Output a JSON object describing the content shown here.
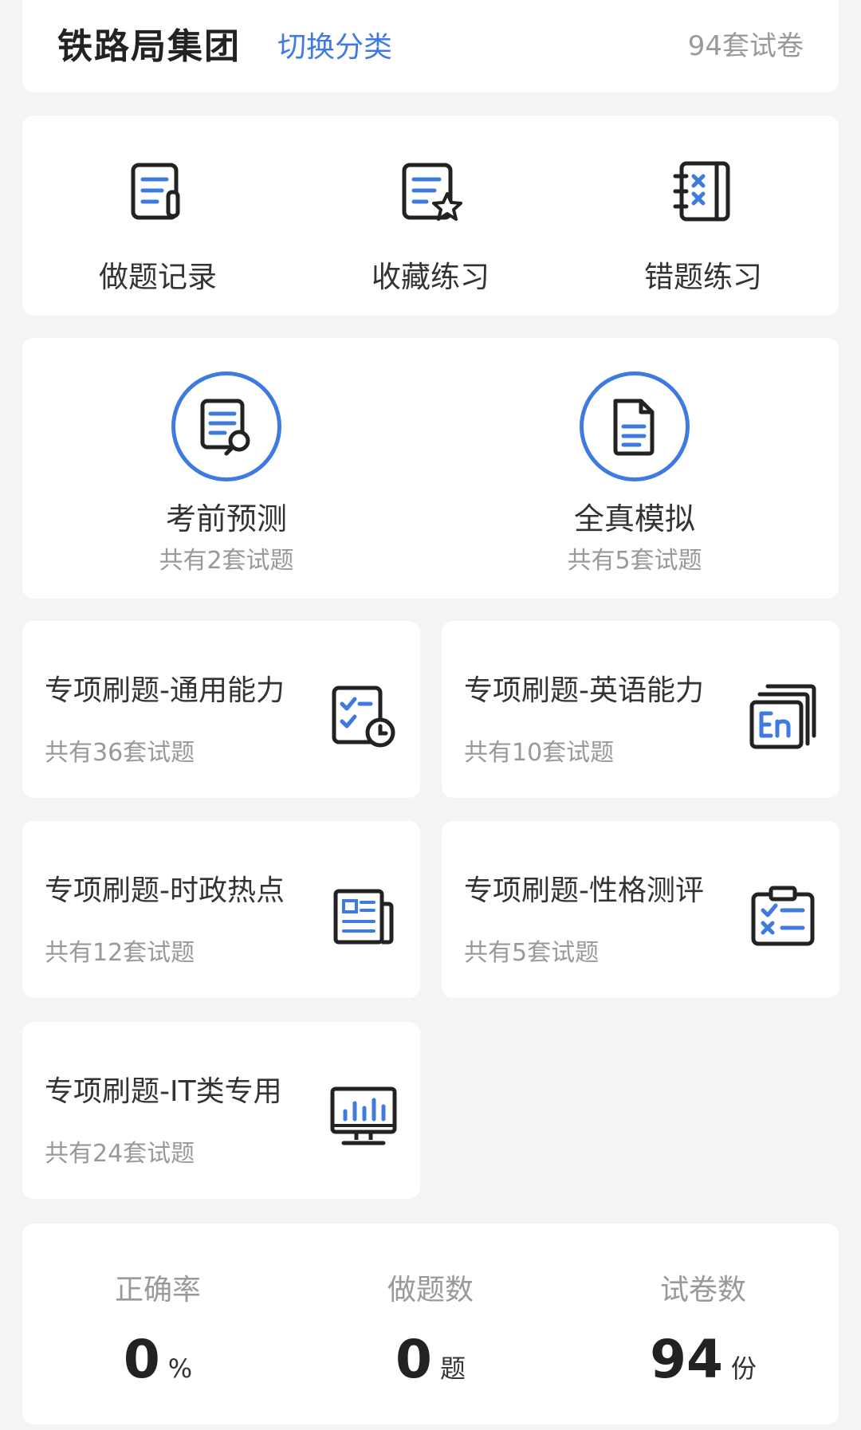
{
  "header": {
    "title": "铁路局集团",
    "switch_label": "切换分类",
    "paper_count": "94套试卷"
  },
  "quick_actions": [
    {
      "label": "做题记录",
      "icon": "record-icon"
    },
    {
      "label": "收藏练习",
      "icon": "favorite-icon"
    },
    {
      "label": "错题练习",
      "icon": "wrong-questions-icon"
    }
  ],
  "featured": [
    {
      "title": "考前预测",
      "subtitle": "共有2套试题",
      "icon": "forecast-icon"
    },
    {
      "title": "全真模拟",
      "subtitle": "共有5套试题",
      "icon": "simulation-icon"
    }
  ],
  "topics": [
    {
      "title": "专项刷题-通用能力",
      "subtitle": "共有36套试题",
      "icon": "checklist-clock-icon"
    },
    {
      "title": "专项刷题-英语能力",
      "subtitle": "共有10套试题",
      "icon": "english-icon"
    },
    {
      "title": "专项刷题-时政热点",
      "subtitle": "共有12套试题",
      "icon": "newspaper-icon"
    },
    {
      "title": "专项刷题-性格测评",
      "subtitle": "共有5套试题",
      "icon": "clipboard-test-icon"
    },
    {
      "title": "专项刷题-IT类专用",
      "subtitle": "共有24套试题",
      "icon": "monitor-chart-icon"
    }
  ],
  "stats": [
    {
      "label": "正确率",
      "value": "0",
      "unit": "%"
    },
    {
      "label": "做题数",
      "value": "0",
      "unit": "题"
    },
    {
      "label": "试卷数",
      "value": "94",
      "unit": "份"
    }
  ],
  "colors": {
    "accent": "#3f7bde",
    "icon_dark": "#222222",
    "background": "#f4f4f4"
  }
}
